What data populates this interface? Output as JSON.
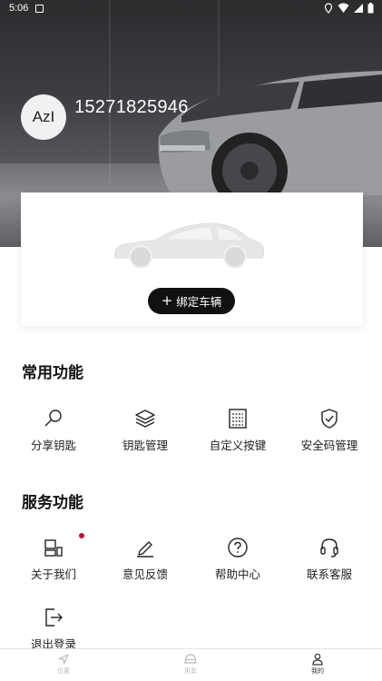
{
  "status_bar": {
    "time": "5:06"
  },
  "profile": {
    "avatar_text": "AzI",
    "phone": "15271825946"
  },
  "vehicle_card": {
    "bind_label": "绑定车辆",
    "bind_icon": "plus-icon"
  },
  "common_section": {
    "title": "常用功能",
    "items": [
      {
        "label": "分享钥匙",
        "icon": "key-share-icon"
      },
      {
        "label": "钥匙管理",
        "icon": "layers-icon"
      },
      {
        "label": "自定义按键",
        "icon": "keypad-icon"
      },
      {
        "label": "安全码管理",
        "icon": "shield-check-icon"
      }
    ]
  },
  "service_section": {
    "title": "服务功能",
    "items": [
      {
        "label": "关于我们",
        "icon": "about-icon",
        "has_badge": true
      },
      {
        "label": "意见反馈",
        "icon": "edit-pen-icon"
      },
      {
        "label": "帮助中心",
        "icon": "help-circle-icon"
      },
      {
        "label": "联系客服",
        "icon": "headset-icon"
      },
      {
        "label": "退出登录",
        "icon": "logout-icon"
      }
    ]
  },
  "bottom_nav": {
    "items": [
      {
        "label": "位置",
        "icon": "location-arrow-icon",
        "active": false
      },
      {
        "label": "用车",
        "icon": "car-front-icon",
        "active": false
      },
      {
        "label": "我的",
        "icon": "person-icon",
        "active": true
      }
    ]
  },
  "colors": {
    "badge": "#b5153a",
    "button_bg": "#111111",
    "active_nav": "#333333",
    "inactive_nav": "#b8b8b8"
  }
}
